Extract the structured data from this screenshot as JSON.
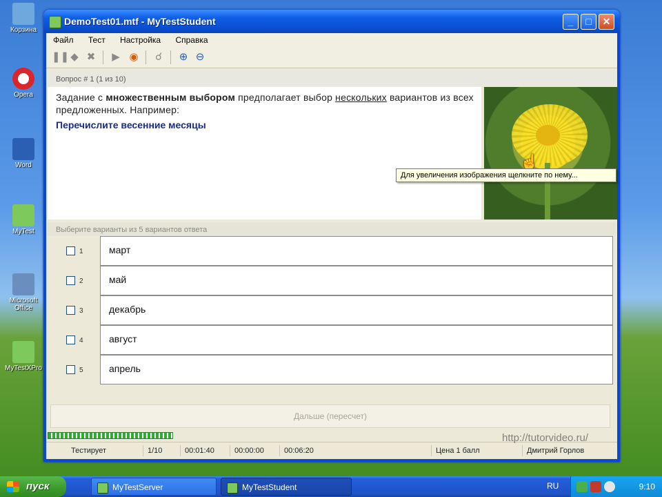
{
  "desktop": {
    "icons": [
      {
        "label": "Корзина",
        "color": "#6fa8dc"
      },
      {
        "label": "Opera",
        "color": "#d9262c"
      },
      {
        "label": "Word",
        "color": "#2b5fb3"
      },
      {
        "label": "MyTest",
        "color": "#7ec95b"
      },
      {
        "label": "Microsoft Office",
        "color": "#6a8fbf"
      },
      {
        "label": "MyTestXPro",
        "color": "#7ec95b"
      }
    ]
  },
  "window": {
    "title": "DemoTest01.mtf - MyTestStudent",
    "buttons": {
      "minimize": "_",
      "maximize": "□",
      "close": "✕"
    }
  },
  "menu": [
    "Файл",
    "Тест",
    "Настройка",
    "Справка"
  ],
  "toolbar": {
    "icons": [
      "pause-icon",
      "stop-icon",
      "tools-icon",
      "play-icon",
      "record-icon",
      "hint-icon",
      "zoom-in-icon",
      "zoom-out-icon"
    ]
  },
  "question": {
    "header": "Вопрос # 1 (1 из 10)",
    "text_plain_1": "Задание с ",
    "text_bold": "множественным выбором",
    "text_plain_2": " предполагает выбор ",
    "text_underline": "нескольких",
    "text_plain_3": " вариантов из всех предложенных. Например:",
    "task": "Перечислите весенние месяцы"
  },
  "image": {
    "tooltip": "Для увеличения изображения щелкните по нему..."
  },
  "answers": {
    "header": "Выберите варианты из 5 вариантов ответа",
    "items": [
      {
        "num": "1",
        "text": "март",
        "checked": false
      },
      {
        "num": "2",
        "text": "май",
        "checked": false
      },
      {
        "num": "3",
        "text": "декабрь",
        "checked": false
      },
      {
        "num": "4",
        "text": "август",
        "checked": false
      },
      {
        "num": "5",
        "text": "апрель",
        "checked": false
      }
    ]
  },
  "next_button": "Дальше (пересчет)",
  "status": {
    "mode": "Тестирует",
    "counter": "1/10",
    "time_total": "00:01:40",
    "time_question": "00:00:00",
    "time_left": "00:06:20",
    "score": "Цена 1 балл",
    "user": "Дмитрий Горлов"
  },
  "watermark": "http://tutorvideo.ru/",
  "taskbar": {
    "start_label": "пуск",
    "tasks": [
      {
        "label": "MyTestServer",
        "active": false
      },
      {
        "label": "MyTestStudent",
        "active": true
      }
    ],
    "lang": "RU",
    "clock": "9:10"
  }
}
